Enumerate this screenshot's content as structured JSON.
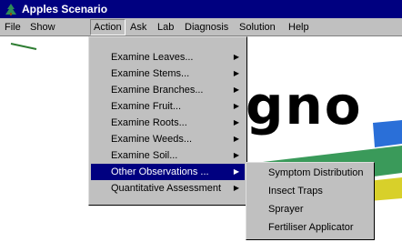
{
  "window": {
    "title": "Apples Scenario"
  },
  "menubar": [
    "File",
    "Show",
    "Action",
    "Ask",
    "Lab",
    "Diagnosis",
    "Solution",
    "Help"
  ],
  "action_menu": [
    "Examine Leaves...",
    "Examine Stems...",
    "Examine Branches...",
    "Examine Fruit...",
    "Examine Roots...",
    "Examine Weeds...",
    "Examine Soil...",
    "Other Observations ...",
    "Quantitative Assessment"
  ],
  "submenu": [
    "Symptom Distribution",
    "Insect Traps",
    "Sprayer",
    "Fertiliser Applicator"
  ],
  "background_text": "gno",
  "colors": {
    "titlebar": "#000080",
    "menu": "#c0c0c0",
    "highlight": "#000080"
  }
}
